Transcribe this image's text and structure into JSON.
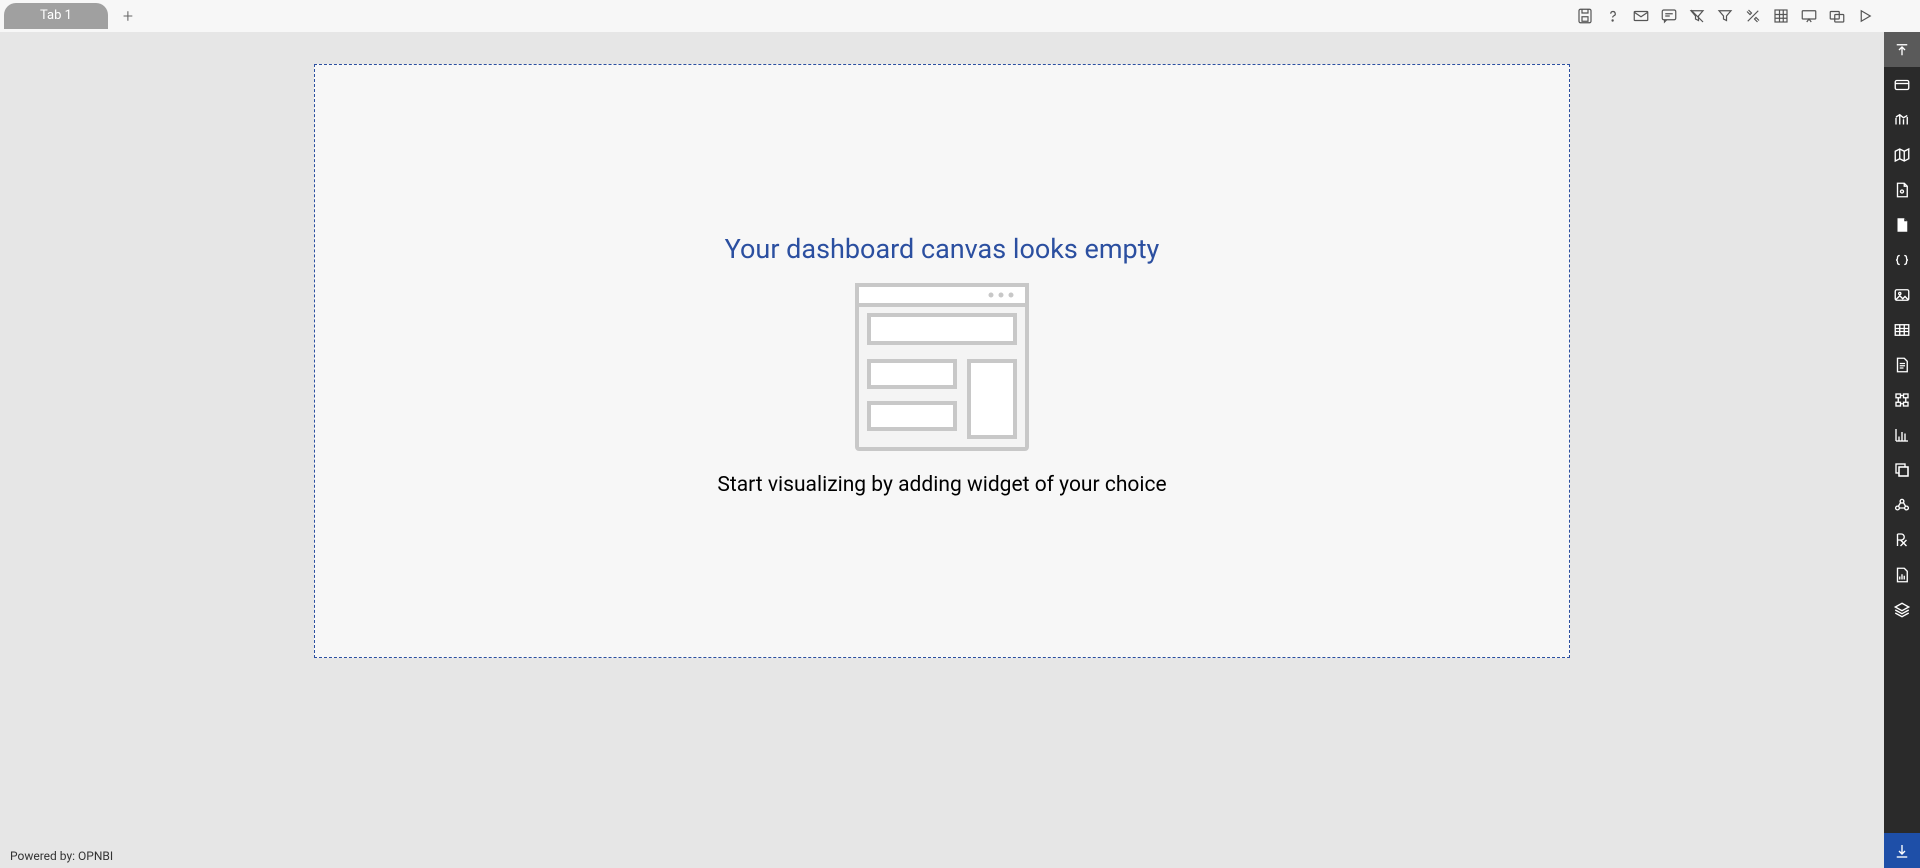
{
  "tabs": {
    "active_label": "Tab 1"
  },
  "top_toolbar": {
    "icons": [
      "save-icon",
      "help-icon",
      "mail-icon",
      "comment-icon",
      "filter-disabled-icon",
      "filter-icon",
      "tools-icon",
      "grid-icon",
      "presentation-icon",
      "share-icon",
      "play-icon"
    ]
  },
  "canvas": {
    "empty_title": "Your dashboard canvas looks empty",
    "empty_sub": "Start visualizing by adding widget of your choice"
  },
  "footer": {
    "powered_by_label": "Powered by:",
    "powered_by_name": "OPNBI"
  },
  "right_sidebar": {
    "items": [
      "collapse-top-icon",
      "card-icon",
      "chart-icon",
      "map-icon",
      "document-icon",
      "file-icon",
      "code-icon",
      "image-icon",
      "table-icon",
      "page-icon",
      "hierarchy-icon",
      "bar-chart-icon",
      "copy-icon",
      "cluster-icon",
      "prescription-icon",
      "report-icon",
      "layers-icon",
      "export-bottom-icon"
    ]
  }
}
